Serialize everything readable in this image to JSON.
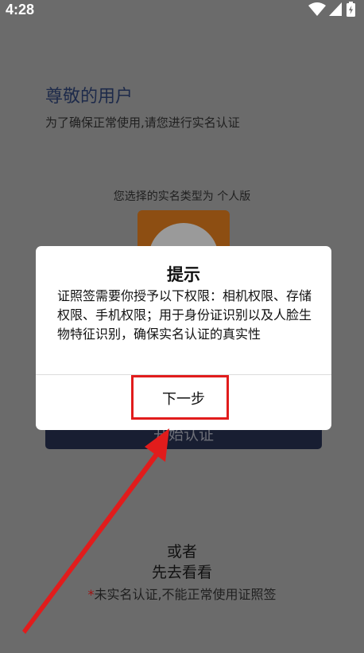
{
  "status_bar": {
    "time": "4:28"
  },
  "page": {
    "title": "尊敬的用户",
    "subtitle": "为了确保正常使用,请您进行实名认证",
    "type_line": "您选择的实名类型为 个人版",
    "start_button": "开始认证",
    "or_text": "或者",
    "browse_link": "先去看看",
    "warning_star": "*",
    "warning_text": "未实名认证,不能正常使用证照签"
  },
  "dialog": {
    "title": "提示",
    "message": "证照签需要你授予以下权限：相机权限、存储权限、手机权限；用于身份证识别以及人脸生物特征识别，确保实名认证的真实性",
    "next_button": "下一步"
  },
  "colors": {
    "scrim": "#6b6b6b",
    "highlight": "#e11c1c",
    "title_navy": "#1d2a4a",
    "button_dark": "#181e32"
  },
  "icons": [
    "wifi-icon",
    "signal-icon",
    "battery-icon"
  ]
}
